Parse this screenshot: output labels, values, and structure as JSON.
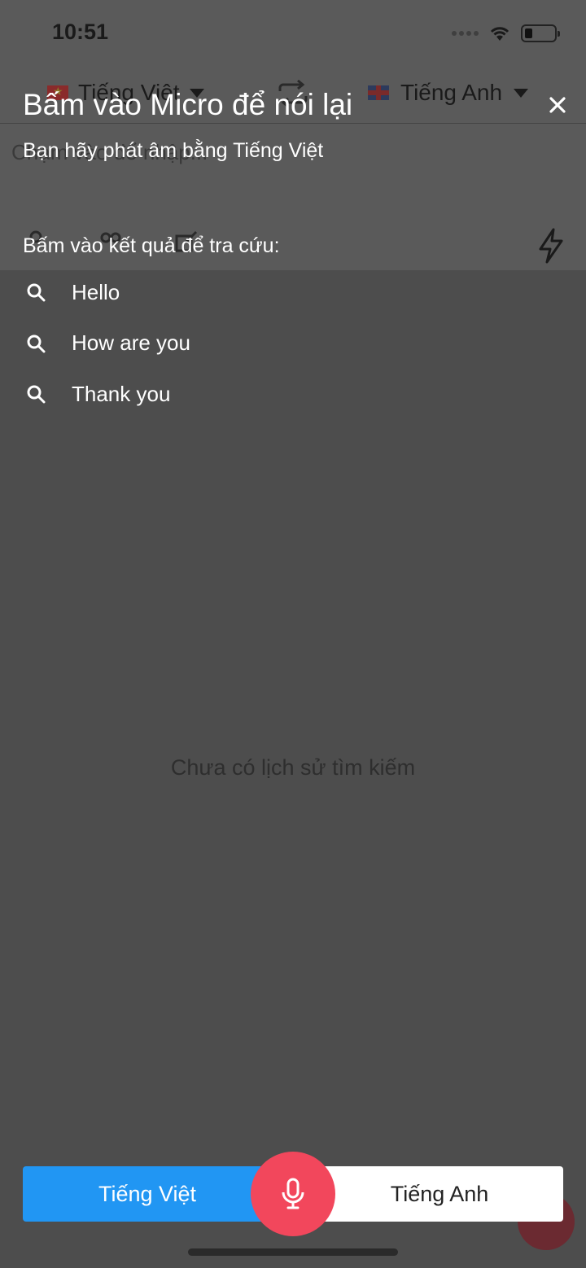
{
  "status": {
    "time": "10:51"
  },
  "languages": {
    "source": "Tiếng Việt",
    "target": "Tiếng Anh"
  },
  "underlying": {
    "placeholder": "Chạm vào để nhập...",
    "empty_history": "Chưa có lịch sử tìm kiếm"
  },
  "overlay": {
    "title": "Bấm vào Micro để nói lại",
    "subtitle": "Bạn hãy phát âm bằng Tiếng Việt",
    "hint": "Bấm vào kết quả để tra cứu:",
    "results": [
      {
        "label": "Hello"
      },
      {
        "label": "How are you"
      },
      {
        "label": "Thank you"
      }
    ]
  },
  "toggle": {
    "left_label": "Tiếng Việt",
    "right_label": "Tiếng Anh"
  },
  "colors": {
    "accent_blue": "#2196f3",
    "mic_red": "#f2475c",
    "overlay_bg": "#4d4d4d"
  },
  "icons": [
    "search-icon",
    "close-icon",
    "microphone-icon",
    "swap-icon",
    "lightning-icon"
  ]
}
